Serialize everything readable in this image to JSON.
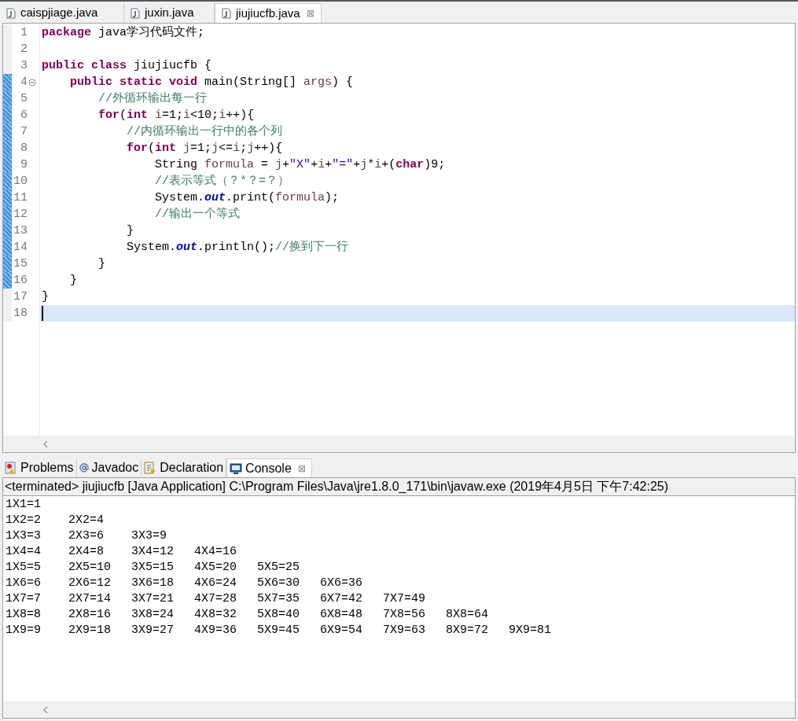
{
  "editor_tabs": [
    {
      "label": "caispjiage.java",
      "selected": false
    },
    {
      "label": "juxin.java",
      "selected": false
    },
    {
      "label": "jiujiucfb.java",
      "selected": true,
      "close": "⊠"
    }
  ],
  "code_lines": [
    {
      "number": "1",
      "changed": false,
      "fold": false,
      "current": false,
      "tokens": [
        {
          "kind": "kw",
          "text": "package"
        },
        {
          "kind": "plain",
          "text": " java学习代码文件;"
        }
      ]
    },
    {
      "number": "2",
      "changed": false,
      "fold": false,
      "current": false
    },
    {
      "number": "3",
      "changed": false,
      "fold": false,
      "current": false,
      "tokens": [
        {
          "kind": "kw",
          "text": "public class"
        },
        {
          "kind": "plain",
          "text": " jiujiucfb {"
        }
      ]
    },
    {
      "number": "4",
      "changed": true,
      "fold": true,
      "current": false,
      "tokens": [
        {
          "kind": "kw",
          "text": "    public static void"
        },
        {
          "kind": "plain",
          "text": " main(String[] "
        },
        {
          "kind": "var",
          "text": "args"
        },
        {
          "kind": "plain",
          "text": ") {"
        }
      ]
    },
    {
      "number": "5",
      "changed": true,
      "fold": false,
      "current": false,
      "tokens": [
        {
          "kind": "comment",
          "text": "        //外循环输出每一行"
        }
      ]
    },
    {
      "number": "6",
      "changed": true,
      "fold": false,
      "current": false,
      "tokens": [
        {
          "kind": "kw",
          "text": "        for"
        },
        {
          "kind": "plain",
          "text": "("
        },
        {
          "kind": "kw",
          "text": "int"
        },
        {
          "kind": "var",
          "text": " i"
        },
        {
          "kind": "plain",
          "text": "=1;"
        },
        {
          "kind": "var",
          "text": "i"
        },
        {
          "kind": "plain",
          "text": "<10;"
        },
        {
          "kind": "var",
          "text": "i"
        },
        {
          "kind": "plain",
          "text": "++){"
        }
      ]
    },
    {
      "number": "7",
      "changed": true,
      "fold": false,
      "current": false,
      "tokens": [
        {
          "kind": "comment",
          "text": "            //内循环输出一行中的各个列"
        }
      ]
    },
    {
      "number": "8",
      "changed": true,
      "fold": false,
      "current": false,
      "tokens": [
        {
          "kind": "kw",
          "text": "            for"
        },
        {
          "kind": "plain",
          "text": "("
        },
        {
          "kind": "kw",
          "text": "int"
        },
        {
          "kind": "var",
          "text": " j"
        },
        {
          "kind": "plain",
          "text": "=1;"
        },
        {
          "kind": "var",
          "text": "j"
        },
        {
          "kind": "plain",
          "text": "<="
        },
        {
          "kind": "var",
          "text": "i"
        },
        {
          "kind": "plain",
          "text": ";"
        },
        {
          "kind": "var",
          "text": "j"
        },
        {
          "kind": "plain",
          "text": "++){"
        }
      ]
    },
    {
      "number": "9",
      "changed": true,
      "fold": false,
      "current": false,
      "tokens": [
        {
          "kind": "plain",
          "text": "                String "
        },
        {
          "kind": "var",
          "text": "formula"
        },
        {
          "kind": "plain",
          "text": " = "
        },
        {
          "kind": "var",
          "text": "j"
        },
        {
          "kind": "plain",
          "text": "+"
        },
        {
          "kind": "string",
          "text": "\"X\""
        },
        {
          "kind": "plain",
          "text": "+"
        },
        {
          "kind": "var",
          "text": "i"
        },
        {
          "kind": "plain",
          "text": "+"
        },
        {
          "kind": "string",
          "text": "\"=\""
        },
        {
          "kind": "plain",
          "text": "+"
        },
        {
          "kind": "var",
          "text": "j"
        },
        {
          "kind": "plain",
          "text": "*"
        },
        {
          "kind": "var",
          "text": "i"
        },
        {
          "kind": "plain",
          "text": "+("
        },
        {
          "kind": "kw",
          "text": "char"
        },
        {
          "kind": "plain",
          "text": ")9;"
        }
      ]
    },
    {
      "number": "10",
      "changed": true,
      "fold": false,
      "current": false,
      "tokens": [
        {
          "kind": "comment",
          "text": "                //表示等式（？*？=？）"
        }
      ]
    },
    {
      "number": "11",
      "changed": true,
      "fold": false,
      "current": false,
      "tokens": [
        {
          "kind": "plain",
          "text": "                System."
        },
        {
          "kind": "field",
          "text": "out"
        },
        {
          "kind": "plain",
          "text": ".print("
        },
        {
          "kind": "var",
          "text": "formula"
        },
        {
          "kind": "plain",
          "text": ");"
        }
      ]
    },
    {
      "number": "12",
      "changed": true,
      "fold": false,
      "current": false,
      "tokens": [
        {
          "kind": "comment",
          "text": "                //输出一个等式"
        }
      ]
    },
    {
      "number": "13",
      "changed": true,
      "fold": false,
      "current": false,
      "tokens": [
        {
          "kind": "plain",
          "text": "            }"
        }
      ]
    },
    {
      "number": "14",
      "changed": true,
      "fold": false,
      "current": false,
      "tokens": [
        {
          "kind": "plain",
          "text": "            System."
        },
        {
          "kind": "field",
          "text": "out"
        },
        {
          "kind": "plain",
          "text": ".println();"
        },
        {
          "kind": "comment",
          "text": "//换到下一行"
        }
      ]
    },
    {
      "number": "15",
      "changed": true,
      "fold": false,
      "current": false,
      "tokens": [
        {
          "kind": "plain",
          "text": "        }"
        }
      ]
    },
    {
      "number": "16",
      "changed": true,
      "fold": false,
      "current": false,
      "tokens": [
        {
          "kind": "plain",
          "text": "    }"
        }
      ]
    },
    {
      "number": "17",
      "changed": false,
      "fold": false,
      "current": false,
      "tokens": [
        {
          "kind": "plain",
          "text": "}"
        }
      ]
    },
    {
      "number": "18",
      "changed": false,
      "fold": false,
      "current": true
    }
  ],
  "view_tabs": [
    {
      "label": "Problems",
      "selected": false
    },
    {
      "label": "Javadoc",
      "selected": false
    },
    {
      "label": "Declaration",
      "selected": false
    },
    {
      "label": "Console",
      "selected": true,
      "close": "⊠"
    }
  ],
  "console": {
    "header": "<terminated> jiujiucfb [Java Application] C:\\Program Files\\Java\\jre1.8.0_171\\bin\\javaw.exe (2019年4月5日 下午7:42:25)",
    "output": [
      [
        "1X1=1"
      ],
      [
        "1X2=2",
        "2X2=4"
      ],
      [
        "1X3=3",
        "2X3=6",
        "3X3=9"
      ],
      [
        "1X4=4",
        "2X4=8",
        "3X4=12",
        "4X4=16"
      ],
      [
        "1X5=5",
        "2X5=10",
        "3X5=15",
        "4X5=20",
        "5X5=25"
      ],
      [
        "1X6=6",
        "2X6=12",
        "3X6=18",
        "4X6=24",
        "5X6=30",
        "6X6=36"
      ],
      [
        "1X7=7",
        "2X7=14",
        "3X7=21",
        "4X7=28",
        "5X7=35",
        "6X7=42",
        "7X7=49"
      ],
      [
        "1X8=8",
        "2X8=16",
        "3X8=24",
        "4X8=32",
        "5X8=40",
        "6X8=48",
        "7X8=56",
        "8X8=64"
      ],
      [
        "1X9=9",
        "2X9=18",
        "3X9=27",
        "4X9=36",
        "5X9=45",
        "6X9=54",
        "7X9=63",
        "8X9=72",
        "9X9=81"
      ]
    ]
  }
}
